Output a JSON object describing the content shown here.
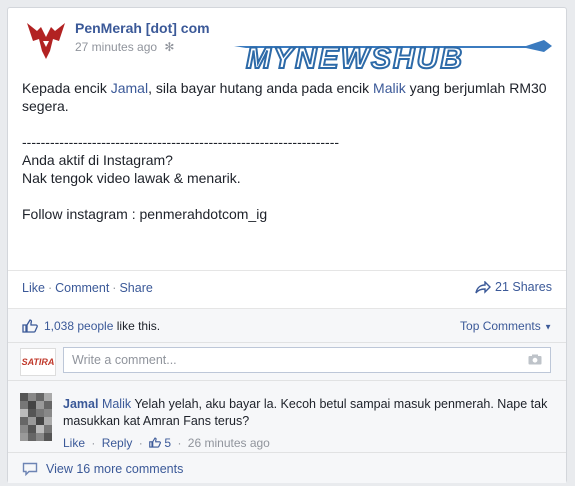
{
  "post": {
    "page_name": "PenMerah [dot] com",
    "timestamp": "27 minutes ago",
    "watermark": "MYNEWSHUB",
    "body_line1_pre": "Kepada encik ",
    "body_name1": "Jamal",
    "body_line1_mid": ", sila bayar hutang anda pada encik ",
    "body_name2": "Malik",
    "body_line1_post": " yang berjumlah RM30 segera.",
    "divider": "--------------------------------------------------------------------",
    "line_q": "Anda aktif di Instagram?",
    "line_video": "Nak tengok video lawak & menarik.",
    "line_follow": "Follow instagram : penmerahdotcom_ig"
  },
  "actions": {
    "like": "Like",
    "comment": "Comment",
    "share": "Share",
    "shares_count": "21 Shares"
  },
  "likes": {
    "count_text": "1,038 people",
    "suffix": "like this.",
    "top_comments": "Top Comments"
  },
  "composer": {
    "placeholder": "Write a comment...",
    "avatar_text": "SATIRA"
  },
  "comment": {
    "name1": "Jamal",
    "name2": "Malik",
    "text": "Yelah yelah, aku bayar la. Kecoh betul sampai masuk penmerah. Nape tak masukkan kat Amran Fans terus?",
    "like": "Like",
    "reply": "Reply",
    "likes": "5",
    "time": "26 minutes ago"
  },
  "more": {
    "label": "View 16 more comments"
  },
  "colors": {
    "link": "#3b5998",
    "meta": "#90949c",
    "text": "#1d2129"
  }
}
